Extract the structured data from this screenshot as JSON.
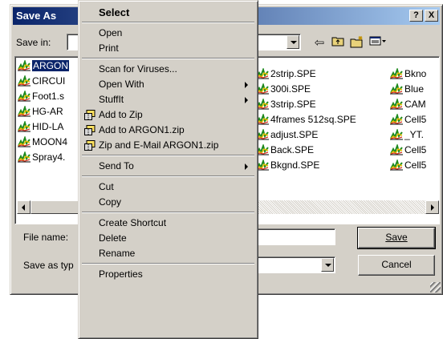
{
  "dialog": {
    "title": "Save As",
    "help_button": "?",
    "close_button": "X",
    "save_in_label": "Save in:",
    "file_name_label": "File name:",
    "save_as_type_label": "Save as typ",
    "save_button": "Save",
    "cancel_button": "Cancel",
    "toolbar_icons": [
      "back-arrow-icon",
      "up-folder-icon",
      "new-folder-icon",
      "view-menu-icon"
    ]
  },
  "files": {
    "column1": [
      "ARGON",
      "CIRCUI",
      "Foot1.s",
      "HG-AR",
      "HID-LA",
      "MOON4",
      "Spray4."
    ],
    "column2": [
      "2strip.SPE",
      "300i.SPE",
      "3strip.SPE",
      "4frames 512sq.SPE",
      "adjust.SPE",
      "Back.SPE",
      "Bkgnd.SPE"
    ],
    "column3": [
      "Bkno",
      "Blue",
      "CAM",
      "Cell5",
      "_YT.",
      "Cell5",
      "Cell5"
    ],
    "selected": "ARGON"
  },
  "context_menu": {
    "items": [
      {
        "label": "Select",
        "bold": true
      },
      {
        "separator": true
      },
      {
        "label": "Open"
      },
      {
        "label": "Print"
      },
      {
        "separator": true
      },
      {
        "label": "Scan for Viruses..."
      },
      {
        "label": "Open With",
        "submenu": true
      },
      {
        "label": "StuffIt",
        "submenu": true
      },
      {
        "label": "Add to Zip",
        "icon": "winzip-icon"
      },
      {
        "label": "Add to ARGON1.zip",
        "icon": "winzip-icon"
      },
      {
        "label": "Zip and E-Mail ARGON1.zip",
        "icon": "winzip-icon"
      },
      {
        "separator": true
      },
      {
        "label": "Send To",
        "submenu": true
      },
      {
        "separator": true
      },
      {
        "label": "Cut"
      },
      {
        "label": "Copy"
      },
      {
        "separator": true
      },
      {
        "label": "Create Shortcut"
      },
      {
        "label": "Delete"
      },
      {
        "label": "Rename"
      },
      {
        "separator": true
      },
      {
        "label": "Properties"
      }
    ]
  },
  "colors": {
    "face": "#d4d0c8",
    "title_gradient_start": "#0a246a",
    "title_gradient_end": "#a6caf0",
    "selection": "#0a246a"
  }
}
